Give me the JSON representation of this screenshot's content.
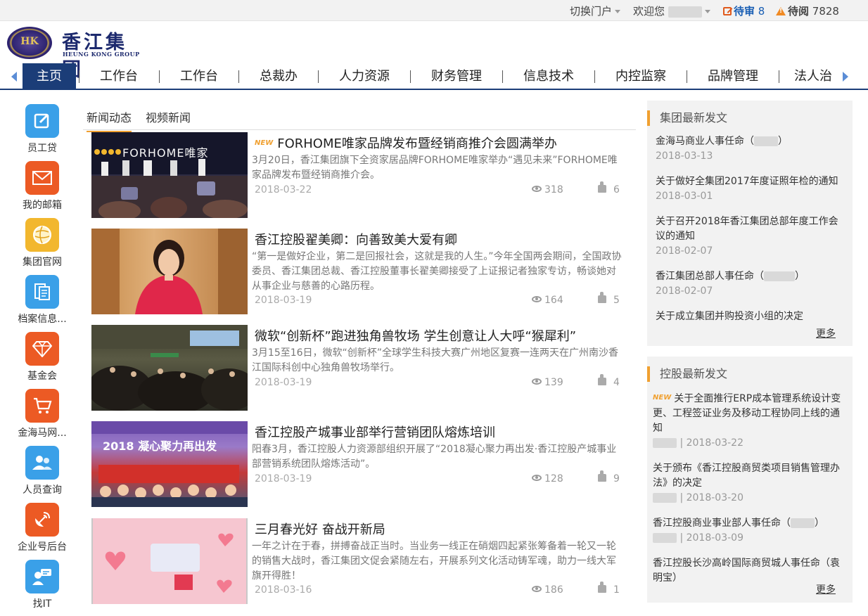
{
  "topbar": {
    "switch_portal": "切换门户",
    "welcome": "欢迎您",
    "pending_review_label": "待审",
    "pending_review_count": "8",
    "pending_read_label": "待阅",
    "pending_read_count": "7828"
  },
  "logo": {
    "cn": "香江集团",
    "en": "HEUNG KONG GROUP",
    "emblem": "HK"
  },
  "nav": {
    "items": [
      {
        "label": "主页"
      },
      {
        "label": "工作台"
      },
      {
        "label": "工作台"
      },
      {
        "label": "总裁办"
      },
      {
        "label": "人力资源"
      },
      {
        "label": "财务管理"
      },
      {
        "label": "信息技术"
      },
      {
        "label": "内控监察"
      },
      {
        "label": "品牌管理"
      },
      {
        "label": "法人治"
      }
    ]
  },
  "apps": [
    {
      "label": "员工贷",
      "icon": "edit-icon",
      "color": "#3aa0e8"
    },
    {
      "label": "我的邮箱",
      "icon": "mail-icon",
      "color": "#ec5a24"
    },
    {
      "label": "集团官网",
      "icon": "globe-icon",
      "color": "#f2b72e"
    },
    {
      "label": "档案信息...",
      "icon": "archive-icon",
      "color": "#3aa0e8"
    },
    {
      "label": "基金会",
      "icon": "diamond-icon",
      "color": "#ec5a24"
    },
    {
      "label": "金海马网...",
      "icon": "cart-icon",
      "color": "#ec5a24"
    },
    {
      "label": "人员查询",
      "icon": "people-icon",
      "color": "#3aa0e8"
    },
    {
      "label": "企业号后台",
      "icon": "satellite-icon",
      "color": "#ec5a24"
    },
    {
      "label": "找IT",
      "icon": "support-icon",
      "color": "#3aa0e8"
    }
  ],
  "news_tabs": [
    {
      "label": "新闻动态"
    },
    {
      "label": "视频新闻"
    }
  ],
  "news": [
    {
      "badge": "NEW",
      "title": "FORHOME唯家品牌发布暨经销商推介会圆满举办",
      "summary": "3月20日，香江集团旗下全资家居品牌FORHOME唯家举办“遇见未来”FORHOME唯家品牌发布暨经销商推介会。",
      "date": "2018-03-22",
      "views": "318",
      "likes": "6",
      "thumb_text": "FORHOME唯家"
    },
    {
      "badge": "",
      "title": "香江控股翟美卿：向善致美大爱有卿",
      "summary": "“第一是做好企业，第二是回报社会，这就是我的人生。”今年全国两会期间，全国政协委员、香江集团总裁、香江控股董事长翟美卿接受了上证报记者独家专访，畅谈她对从事企业与慈善的心路历程。",
      "date": "2018-03-19",
      "views": "164",
      "likes": "5",
      "thumb_text": ""
    },
    {
      "badge": "",
      "title": "微软“创新杯”跑进独角兽牧场  学生创意让人大呼“猴犀利”",
      "summary": "3月15至16日，微软“创新杯”全球学生科技大赛广州地区复赛一连两天在广州南沙香江国际科创中心独角兽牧场举行。",
      "date": "2018-03-19",
      "views": "139",
      "likes": "4",
      "thumb_text": ""
    },
    {
      "badge": "",
      "title": "香江控股产城事业部举行营销团队熔炼培训",
      "summary": "阳春3月，香江控股人力资源部组织开展了“2018凝心聚力再出发·香江控股产城事业部营销系统团队熔炼活动”。",
      "date": "2018-03-19",
      "views": "128",
      "likes": "9",
      "thumb_text": "2018 凝心聚力再出发"
    },
    {
      "badge": "",
      "title": "三月春光好 奋战开新局",
      "summary": "一年之计在于春，拼搏奋战正当时。当业务一线正在硝烟四起紧张筹备着一轮又一轮的销售大战时，香江集团文促会紧随左右，开展系列文化活动铸军魂，助力一线大军旗开得胜！",
      "date": "2018-03-16",
      "views": "186",
      "likes": "1",
      "thumb_text": ""
    }
  ],
  "group_panel": {
    "title": "集团最新发文",
    "more": "更多",
    "items": [
      {
        "title": "金海马商业人事任命（",
        "tail": "）",
        "date": "2018-03-13"
      },
      {
        "title": "关于做好全集团2017年度证照年检的通知",
        "tail": "",
        "date": "2018-03-01"
      },
      {
        "title": "关于召开2018年香江集团总部年度工作会议的通知",
        "tail": "",
        "date": "2018-02-07"
      },
      {
        "title": "香江集团总部人事任命（",
        "tail": "）",
        "date": "2018-02-07"
      },
      {
        "title": "关于成立集团并购投资小组的决定",
        "tail": "",
        "date": ""
      }
    ]
  },
  "holding_panel": {
    "title": "控股最新发文",
    "more": "更多",
    "items": [
      {
        "badge": "NEW",
        "title": "关于全面推行ERP成本管理系统设计变更、工程签证业务及移动工程协同上线的通知",
        "tail": "",
        "date": "| 2018-03-22"
      },
      {
        "badge": "",
        "title": "关于颁布《香江控股商贸类项目销售管理办法》的决定",
        "tail": "",
        "date": "| 2018-03-20"
      },
      {
        "badge": "",
        "title": "香江控股商业事业部人事任命（",
        "tail": "）",
        "date": "| 2018-03-09"
      },
      {
        "badge": "",
        "title": "香江控股长沙高岭国际商贸城人事任命（袁明宝）",
        "tail": "",
        "date": ""
      }
    ]
  }
}
